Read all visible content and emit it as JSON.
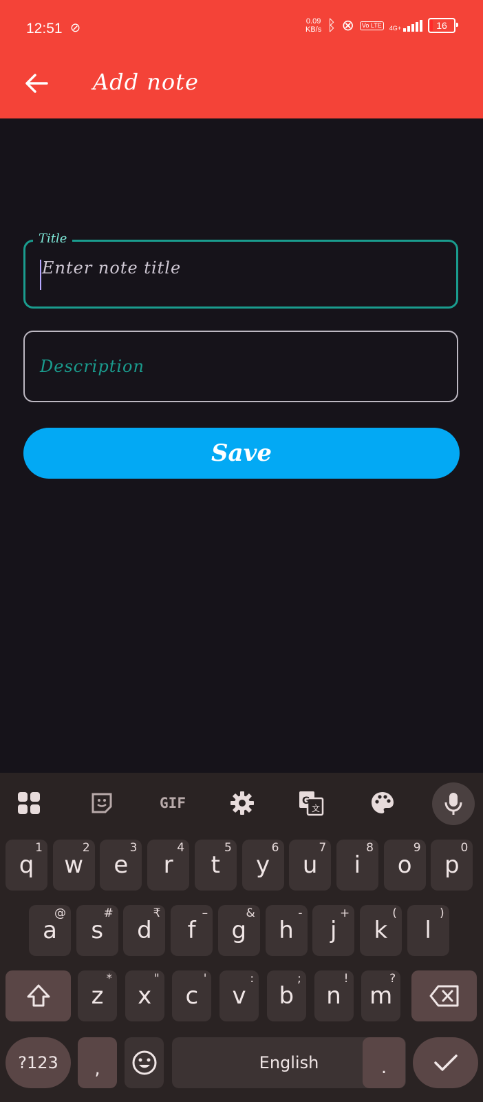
{
  "status_bar": {
    "time": "12:51",
    "net_speed_value": "0.09",
    "net_speed_unit": "KB/s",
    "volte": "Vo LTE",
    "network": "4G+",
    "battery": "16"
  },
  "app_bar": {
    "title": "Add note",
    "back_icon": "arrow-left-icon"
  },
  "form": {
    "title_label": "Title",
    "title_placeholder": "Enter note title",
    "description_placeholder": "Description",
    "save_label": "Save"
  },
  "colors": {
    "app_bar": "#f44338",
    "background": "#16131a",
    "focus_outline": "#1a9c8e",
    "save_button": "#03a9f4",
    "keyboard_bg": "#2a2323"
  },
  "keyboard": {
    "toolbar_icons": [
      "apps-grid-icon",
      "sticker-icon",
      "GIF",
      "settings-gear-icon",
      "translate-icon",
      "palette-icon",
      "microphone-icon"
    ],
    "gif_label": "GIF",
    "row1": [
      {
        "k": "q",
        "s": "1"
      },
      {
        "k": "w",
        "s": "2"
      },
      {
        "k": "e",
        "s": "3"
      },
      {
        "k": "r",
        "s": "4"
      },
      {
        "k": "t",
        "s": "5"
      },
      {
        "k": "y",
        "s": "6"
      },
      {
        "k": "u",
        "s": "7"
      },
      {
        "k": "i",
        "s": "8"
      },
      {
        "k": "o",
        "s": "9"
      },
      {
        "k": "p",
        "s": "0"
      }
    ],
    "row2": [
      {
        "k": "a",
        "s": "@"
      },
      {
        "k": "s",
        "s": "#"
      },
      {
        "k": "d",
        "s": "₹"
      },
      {
        "k": "f",
        "s": "–"
      },
      {
        "k": "g",
        "s": "&"
      },
      {
        "k": "h",
        "s": "-"
      },
      {
        "k": "j",
        "s": "+"
      },
      {
        "k": "k",
        "s": "("
      },
      {
        "k": "l",
        "s": ")"
      }
    ],
    "row3": [
      {
        "k": "z",
        "s": "*"
      },
      {
        "k": "x",
        "s": "\""
      },
      {
        "k": "c",
        "s": "'"
      },
      {
        "k": "v",
        "s": ":"
      },
      {
        "k": "b",
        "s": ";"
      },
      {
        "k": "n",
        "s": "!"
      },
      {
        "k": "m",
        "s": "?"
      }
    ],
    "symbols_label": "?123",
    "comma_label": ",",
    "space_label": "English",
    "period_label": ".",
    "shift_icon": "shift-icon",
    "backspace_icon": "backspace-icon",
    "emoji_icon": "emoji-icon",
    "enter_icon": "checkmark-icon"
  }
}
